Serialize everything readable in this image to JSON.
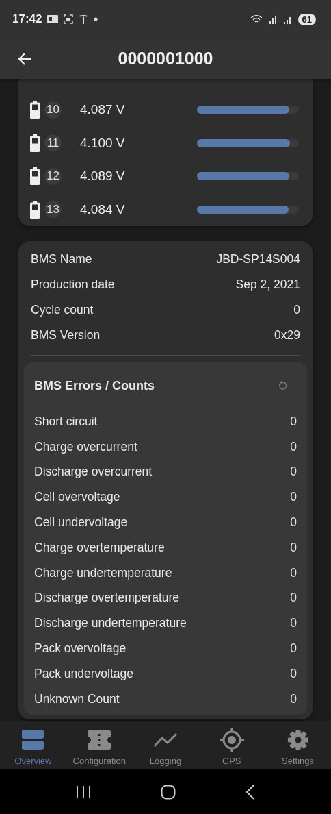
{
  "status_bar": {
    "time": "17:42",
    "battery": "61"
  },
  "app_bar": {
    "title": "0000001000"
  },
  "cells": [
    {
      "index": "10",
      "voltage": "4.087 V",
      "level": 0.905
    },
    {
      "index": "11",
      "voltage": "4.100 V",
      "level": 0.915
    },
    {
      "index": "12",
      "voltage": "4.089 V",
      "level": 0.906
    },
    {
      "index": "13",
      "voltage": "4.084 V",
      "level": 0.9
    }
  ],
  "bms_info": [
    {
      "label": "BMS Name",
      "value": "JBD-SP14S004"
    },
    {
      "label": "Production date",
      "value": "Sep 2, 2021"
    },
    {
      "label": "Cycle count",
      "value": "0"
    },
    {
      "label": "BMS Version",
      "value": "0x29"
    }
  ],
  "errors": {
    "title": "BMS Errors / Counts",
    "rows": [
      {
        "label": "Short circuit",
        "value": "0"
      },
      {
        "label": "Charge overcurrent",
        "value": "0"
      },
      {
        "label": "Discharge overcurrent",
        "value": "0"
      },
      {
        "label": "Cell overvoltage",
        "value": "0"
      },
      {
        "label": "Cell undervoltage",
        "value": "0"
      },
      {
        "label": "Charge overtemperature",
        "value": "0"
      },
      {
        "label": "Charge undertemperature",
        "value": "0"
      },
      {
        "label": "Discharge overtemperature",
        "value": "0"
      },
      {
        "label": "Discharge undertemperature",
        "value": "0"
      },
      {
        "label": "Pack overvoltage",
        "value": "0"
      },
      {
        "label": "Pack undervoltage",
        "value": "0"
      },
      {
        "label": "Unknown Count",
        "value": "0"
      }
    ]
  },
  "bottom_nav": [
    {
      "kind": "overview",
      "label": "Overview",
      "selected": true
    },
    {
      "kind": "configuration",
      "label": "Configuration",
      "selected": false
    },
    {
      "kind": "logging",
      "label": "Logging",
      "selected": false
    },
    {
      "kind": "gps",
      "label": "GPS",
      "selected": false
    },
    {
      "kind": "settings",
      "label": "Settings",
      "selected": false
    }
  ]
}
